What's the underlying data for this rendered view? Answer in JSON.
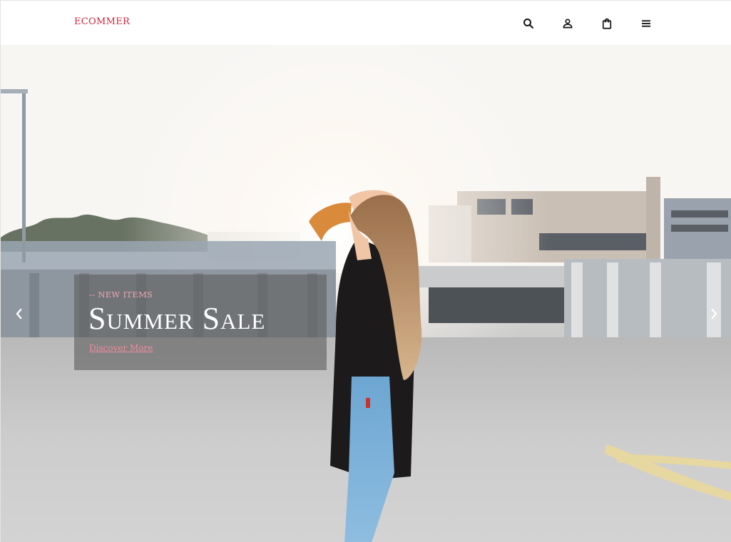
{
  "header": {
    "logo": "ECOMMER",
    "icons": [
      "search-icon",
      "account-icon",
      "shopping-bag-icon",
      "menu-icon"
    ]
  },
  "hero": {
    "kicker": "-- NEW ITEMS",
    "title": "Summer Sale",
    "link_label": "Discover More",
    "controls": [
      "chevron-left-icon",
      "chevron-right-icon"
    ]
  },
  "colors": {
    "brand": "#d0263d",
    "kicker": "#f0a5b0",
    "link": "#f28b9b",
    "caption_bg": "rgba(96,96,96,0.62)"
  }
}
